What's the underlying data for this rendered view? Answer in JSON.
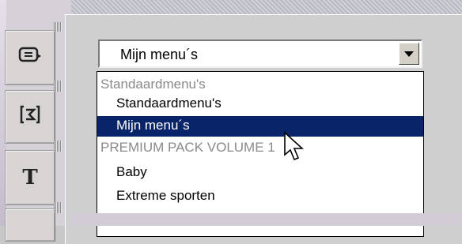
{
  "left_tabs": [
    {
      "icon": "menu-icon"
    },
    {
      "icon": "chapter-icon"
    },
    {
      "icon": "title-text-icon",
      "glyph": "T"
    }
  ],
  "menu_select": {
    "value": "Mijn menu´s",
    "arrow_icon": "chevron-down-icon",
    "options": [
      {
        "label": "Standaardmenu's",
        "kind": "group"
      },
      {
        "label": "Standaardmenu's",
        "kind": "child"
      },
      {
        "label": "Mijn menu´s",
        "kind": "child",
        "selected": true
      },
      {
        "label": "PREMIUM PACK VOLUME 1",
        "kind": "group"
      },
      {
        "label": "Baby",
        "kind": "child"
      },
      {
        "label": "Extreme sporten",
        "kind": "child"
      }
    ]
  },
  "colors": {
    "selection_background": "#0a246a",
    "group_text": "#8a8a8a"
  },
  "cursor_icon": "pointer-cursor-icon"
}
